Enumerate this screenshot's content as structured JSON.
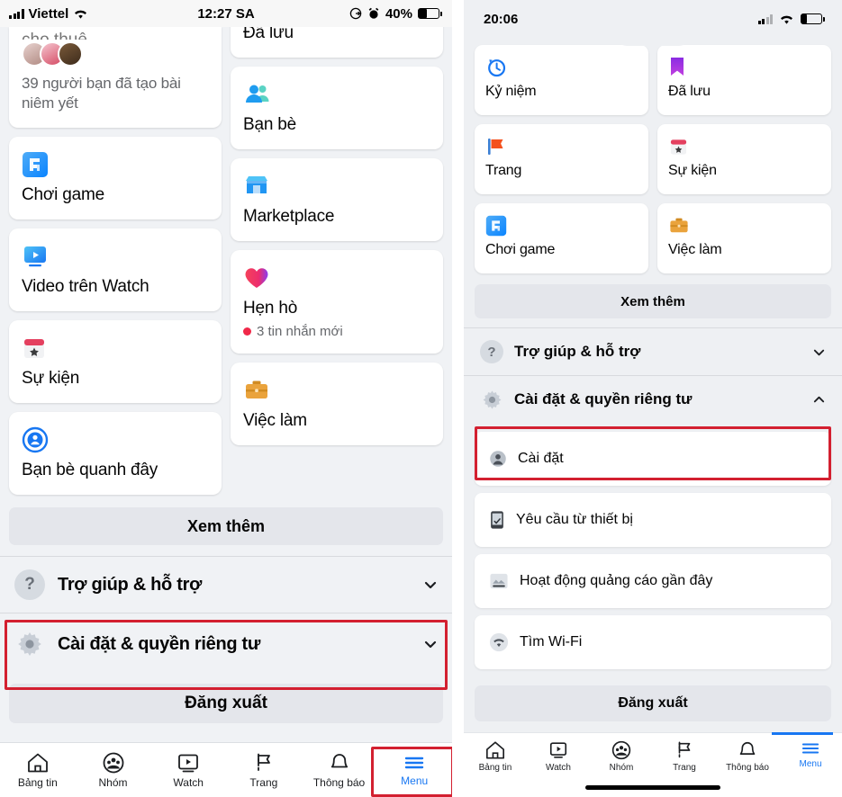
{
  "left_phone": {
    "status_bar": {
      "carrier": "Viettel",
      "time": "12:27 SA",
      "battery_percent": "40%",
      "icons": [
        "signal-bars-icon",
        "wifi-icon",
        "rotation-lock-icon",
        "alarm-clock-icon",
        "battery-icon"
      ]
    },
    "clipped_card": {
      "clipped_title": "cho thuê",
      "subtitle": "39 người bạn đã tạo bài niêm yết",
      "avatar_count": 3
    },
    "left_column_cards": [
      {
        "label": "Chơi game",
        "icon": "gaming-icon"
      },
      {
        "label": "Video trên Watch",
        "icon": "watch-video-icon"
      },
      {
        "label": "Sự kiện",
        "icon": "events-calendar-icon"
      },
      {
        "label": "Bạn bè quanh đây",
        "icon": "nearby-friends-icon"
      }
    ],
    "right_column_cards": [
      {
        "label": "Đã lưu",
        "icon": "bookmark-icon"
      },
      {
        "label": "Bạn bè",
        "icon": "friends-icon"
      },
      {
        "label": "Marketplace",
        "icon": "marketplace-icon"
      },
      {
        "label": "Hẹn hò",
        "icon": "dating-heart-icon",
        "badge": "3 tin nhắn mới"
      },
      {
        "label": "Việc làm",
        "icon": "jobs-briefcase-icon"
      }
    ],
    "see_more_label": "Xem thêm",
    "help_row": {
      "label": "Trợ giúp & hỗ trợ",
      "icon": "question-mark-icon",
      "chevron": "chevron-down-icon"
    },
    "settings_row": {
      "label": "Cài đặt & quyền riêng tư",
      "icon": "gear-icon",
      "chevron": "chevron-down-icon"
    },
    "logout_label": "Đăng xuất",
    "tabs": [
      {
        "label": "Bảng tin",
        "icon": "home-icon",
        "active": false
      },
      {
        "label": "Nhóm",
        "icon": "groups-icon",
        "active": false
      },
      {
        "label": "Watch",
        "icon": "watch-icon",
        "active": false
      },
      {
        "label": "Trang",
        "icon": "pages-flag-icon",
        "active": false
      },
      {
        "label": "Thông báo",
        "icon": "bell-icon",
        "active": false
      },
      {
        "label": "Menu",
        "icon": "hamburger-menu-icon",
        "active": true
      }
    ]
  },
  "right_phone": {
    "status_bar": {
      "time": "20:06",
      "icons": [
        "signal-bars-icon",
        "wifi-icon",
        "battery-icon"
      ]
    },
    "grid_cards": [
      {
        "label": "Kỷ niệm",
        "icon": "memories-clock-icon"
      },
      {
        "label": "Đã lưu",
        "icon": "bookmark-icon"
      },
      {
        "label": "Trang",
        "icon": "pages-flag-icon"
      },
      {
        "label": "Sự kiện",
        "icon": "events-calendar-icon"
      },
      {
        "label": "Chơi game",
        "icon": "gaming-icon"
      },
      {
        "label": "Việc làm",
        "icon": "jobs-briefcase-icon"
      }
    ],
    "see_more_label": "Xem thêm",
    "help_row": {
      "label": "Trợ giúp & hỗ trợ",
      "icon": "question-mark-icon",
      "chevron": "chevron-down-icon"
    },
    "settings_row": {
      "label": "Cài đặt & quyền riêng tư",
      "icon": "gear-icon",
      "chevron": "chevron-up-icon"
    },
    "sub_items": [
      {
        "label": "Cài đặt",
        "icon": "account-avatar-icon",
        "highlighted": true
      },
      {
        "label": "Yêu cầu từ thiết bị",
        "icon": "device-request-icon",
        "highlighted": false
      },
      {
        "label": "Hoạt động quảng cáo gần đây",
        "icon": "ad-activity-icon",
        "highlighted": false
      },
      {
        "label": "Tìm Wi-Fi",
        "icon": "wifi-find-icon",
        "highlighted": false
      }
    ],
    "logout_label": "Đăng xuất",
    "tabs": [
      {
        "label": "Bảng tin",
        "icon": "home-icon",
        "active": false
      },
      {
        "label": "Watch",
        "icon": "watch-icon",
        "active": false
      },
      {
        "label": "Nhóm",
        "icon": "groups-icon",
        "active": false
      },
      {
        "label": "Trang",
        "icon": "pages-flag-icon",
        "active": false
      },
      {
        "label": "Thông báo",
        "icon": "bell-icon",
        "active": false
      },
      {
        "label": "Menu",
        "icon": "hamburger-menu-icon",
        "active": true
      }
    ]
  },
  "annotations": {
    "highlight_color": "#d32030",
    "boxes": [
      "left-settings-privacy-row",
      "left-menu-tab",
      "right-settings-subitem",
      "right-menu-tab"
    ]
  }
}
